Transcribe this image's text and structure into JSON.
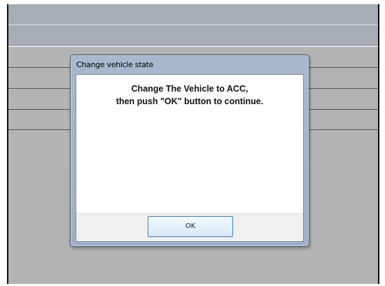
{
  "dialog": {
    "title": "Change vehicle state",
    "message_line1": "Change The Vehicle to ACC,",
    "message_line2": "then push \"OK\" button to continue.",
    "ok_label": "OK"
  },
  "colors": {
    "background": "#b3b3b3",
    "header_band": "#a6adb4",
    "dialog_frame": "#a8b8cf",
    "button_border": "#3c7fb1"
  }
}
